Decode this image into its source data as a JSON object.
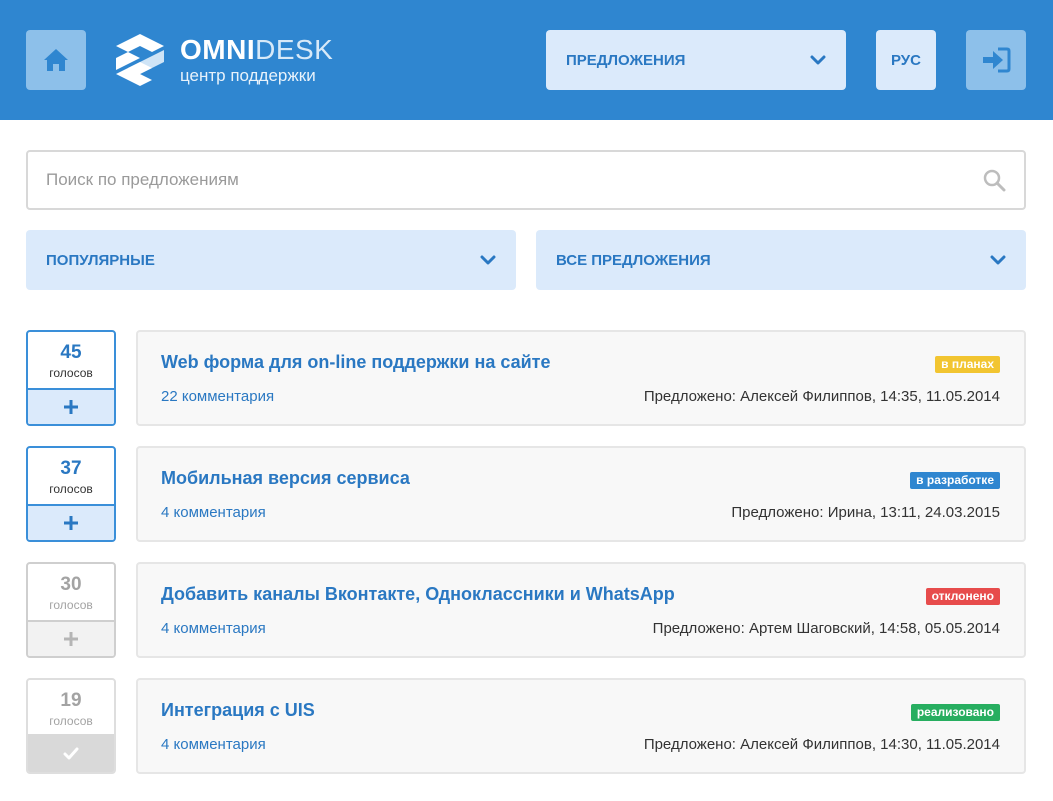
{
  "header": {
    "brand_bold": "OMNI",
    "brand_light": "DESK",
    "brand_sub": "центр поддержки",
    "section_select": "ПРЕДЛОЖЕНИЯ",
    "language": "РУС",
    "home_icon": "home-icon",
    "login_icon": "sign-in-icon"
  },
  "search": {
    "placeholder": "Поиск по предложениям",
    "value": ""
  },
  "filters": {
    "sort": "ПОПУЛЯРНЫЕ",
    "status": "ВСЕ ПРЕДЛОЖЕНИЯ"
  },
  "colors": {
    "header_bg": "#2f86d0",
    "accent": "#2a78c2",
    "badge_planned": "#f2c531",
    "badge_in_progress": "#2f86d0",
    "badge_rejected": "#e74c4c",
    "badge_done": "#27ae60"
  },
  "suggestions": [
    {
      "votes": "45",
      "votes_label": "голосов",
      "title": "Web форма для on-line поддержки на сайте",
      "status": "в планах",
      "comments": "22 комментария",
      "meta": "Предложено: Алексей Филиппов, 14:35, 11.05.2014"
    },
    {
      "votes": "37",
      "votes_label": "голосов",
      "title": "Мобильная версия сервиса",
      "status": "в разработке",
      "comments": "4 комментария",
      "meta": "Предложено: Ирина, 13:11, 24.03.2015"
    },
    {
      "votes": "30",
      "votes_label": "голосов",
      "title": "Добавить каналы Вконтакте, Одноклассники и WhatsApp",
      "status": "отклонено",
      "comments": "4 комментария",
      "meta": "Предложено: Артем Шаговский, 14:58, 05.05.2014"
    },
    {
      "votes": "19",
      "votes_label": "голосов",
      "title": "Интеграция с UIS",
      "status": "реализовано",
      "comments": "4 комментария",
      "meta": "Предложено: Алексей Филиппов, 14:30, 11.05.2014"
    }
  ]
}
